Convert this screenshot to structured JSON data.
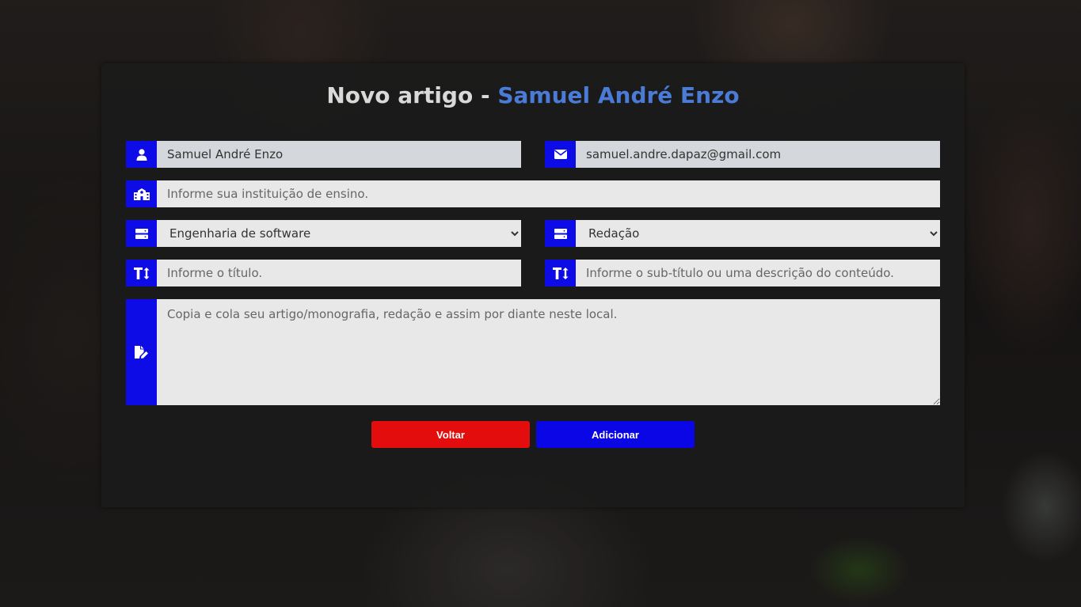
{
  "header": {
    "title_prefix": "Novo artigo - ",
    "title_name": "Samuel André Enzo"
  },
  "form": {
    "name_value": "Samuel André Enzo",
    "email_value": "samuel.andre.dapaz@gmail.com",
    "institution_placeholder": "Informe sua instituição de ensino.",
    "area_selected": "Engenharia de software",
    "type_selected": "Redação",
    "title_placeholder": "Informe o título.",
    "subtitle_placeholder": "Informe o sub-título ou uma descrição do conteúdo.",
    "content_placeholder": "Copia e cola seu artigo/monografia, redação e assim por diante neste local."
  },
  "buttons": {
    "back_label": "Voltar",
    "add_label": "Adicionar"
  },
  "icons": {
    "name": "user-icon",
    "email": "envelope-icon",
    "institution": "school-icon",
    "area": "server-icon",
    "type": "server-icon",
    "title": "text-height-icon",
    "subtitle": "text-height-icon",
    "content": "file-edit-icon"
  },
  "colors": {
    "accent_title": "#4a7bd6",
    "icon_bg": "#0e0ce6",
    "back_button": "#e30d0d",
    "add_button": "#0b06e6"
  }
}
